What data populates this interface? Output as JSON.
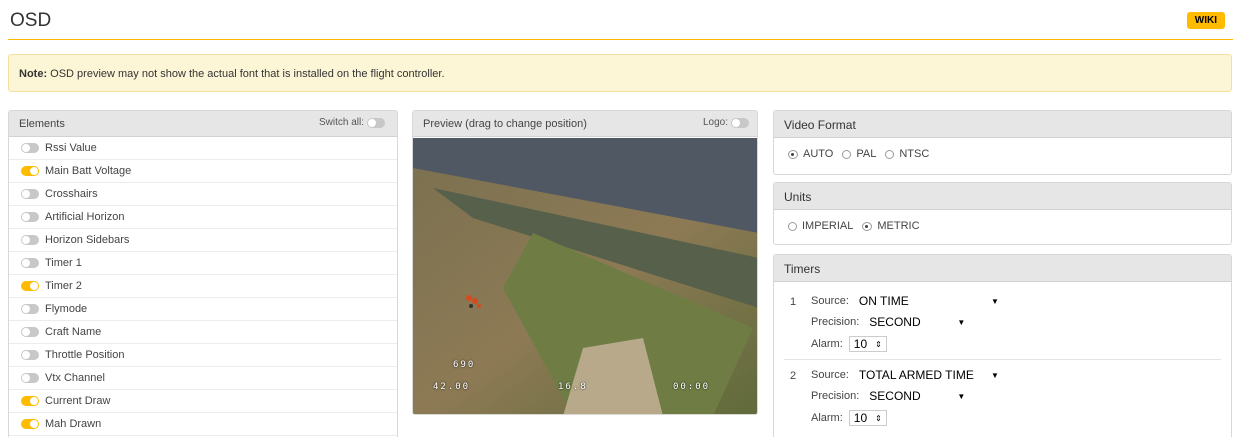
{
  "header": {
    "title": "OSD",
    "wiki_label": "WIKI"
  },
  "note": {
    "label": "Note:",
    "text": " OSD preview may not show the actual font that is installed on the flight controller."
  },
  "elements": {
    "title": "Elements",
    "switch_all_label": "Switch all:",
    "items": [
      {
        "label": "Rssi Value",
        "enabled": false
      },
      {
        "label": "Main Batt Voltage",
        "enabled": true
      },
      {
        "label": "Crosshairs",
        "enabled": false
      },
      {
        "label": "Artificial Horizon",
        "enabled": false
      },
      {
        "label": "Horizon Sidebars",
        "enabled": false
      },
      {
        "label": "Timer 1",
        "enabled": false
      },
      {
        "label": "Timer 2",
        "enabled": true
      },
      {
        "label": "Flymode",
        "enabled": false
      },
      {
        "label": "Craft Name",
        "enabled": false
      },
      {
        "label": "Throttle Position",
        "enabled": false
      },
      {
        "label": "Vtx Channel",
        "enabled": false
      },
      {
        "label": "Current Draw",
        "enabled": true
      },
      {
        "label": "Mah Drawn",
        "enabled": true
      }
    ]
  },
  "preview": {
    "title": "Preview (drag to change position)",
    "logo_label": "Logo:",
    "osd": {
      "mah": "690",
      "current": "42.00",
      "voltage": "16.8",
      "timer": "00:00"
    }
  },
  "video_format": {
    "title": "Video Format",
    "options": [
      "AUTO",
      "PAL",
      "NTSC"
    ],
    "selected": "AUTO"
  },
  "units": {
    "title": "Units",
    "options": [
      "IMPERIAL",
      "METRIC"
    ],
    "selected": "METRIC"
  },
  "timers": {
    "title": "Timers",
    "source_label": "Source:",
    "precision_label": "Precision:",
    "alarm_label": "Alarm:",
    "items": [
      {
        "number": "1",
        "source": "ON TIME",
        "precision": "SECOND",
        "alarm": "10"
      },
      {
        "number": "2",
        "source": "TOTAL ARMED TIME",
        "precision": "SECOND",
        "alarm": "10"
      }
    ]
  },
  "colors": {
    "accent": "#ffbb00",
    "note_bg": "#fdf6d6"
  }
}
